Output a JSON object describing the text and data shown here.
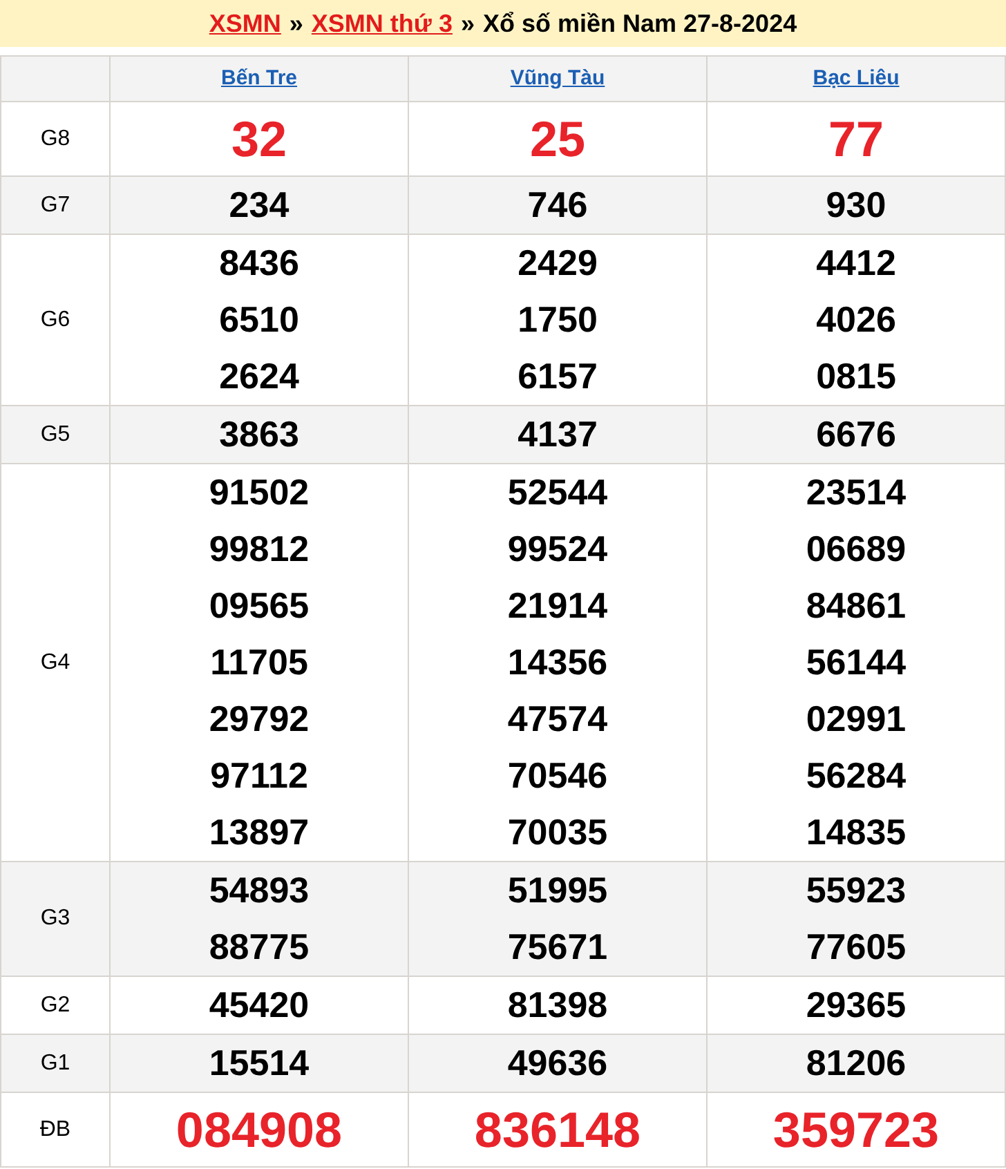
{
  "breadcrumb": {
    "links": [
      "XSMN",
      "XSMN thứ 3"
    ],
    "separator": "»",
    "title": "Xổ số miền Nam 27-8-2024"
  },
  "table": {
    "columns": [
      "Bến Tre",
      "Vũng Tàu",
      "Bạc Liêu"
    ],
    "rows": [
      {
        "label": "G8",
        "kind": "big",
        "cells": [
          [
            "32"
          ],
          [
            "25"
          ],
          [
            "77"
          ]
        ]
      },
      {
        "label": "G7",
        "kind": "normal",
        "cells": [
          [
            "234"
          ],
          [
            "746"
          ],
          [
            "930"
          ]
        ]
      },
      {
        "label": "G6",
        "kind": "normal",
        "cells": [
          [
            "8436",
            "6510",
            "2624"
          ],
          [
            "2429",
            "1750",
            "6157"
          ],
          [
            "4412",
            "4026",
            "0815"
          ]
        ]
      },
      {
        "label": "G5",
        "kind": "normal",
        "cells": [
          [
            "3863"
          ],
          [
            "4137"
          ],
          [
            "6676"
          ]
        ]
      },
      {
        "label": "G4",
        "kind": "normal",
        "cells": [
          [
            "91502",
            "99812",
            "09565",
            "11705",
            "29792",
            "97112",
            "13897"
          ],
          [
            "52544",
            "99524",
            "21914",
            "14356",
            "47574",
            "70546",
            "70035"
          ],
          [
            "23514",
            "06689",
            "84861",
            "56144",
            "02991",
            "56284",
            "14835"
          ]
        ]
      },
      {
        "label": "G3",
        "kind": "normal",
        "cells": [
          [
            "54893",
            "88775"
          ],
          [
            "51995",
            "75671"
          ],
          [
            "55923",
            "77605"
          ]
        ]
      },
      {
        "label": "G2",
        "kind": "normal",
        "cells": [
          [
            "45420"
          ],
          [
            "81398"
          ],
          [
            "29365"
          ]
        ]
      },
      {
        "label": "G1",
        "kind": "normal",
        "cells": [
          [
            "15514"
          ],
          [
            "49636"
          ],
          [
            "81206"
          ]
        ]
      },
      {
        "label": "ĐB",
        "kind": "big",
        "cells": [
          [
            "084908"
          ],
          [
            "836148"
          ],
          [
            "359723"
          ]
        ]
      }
    ]
  }
}
